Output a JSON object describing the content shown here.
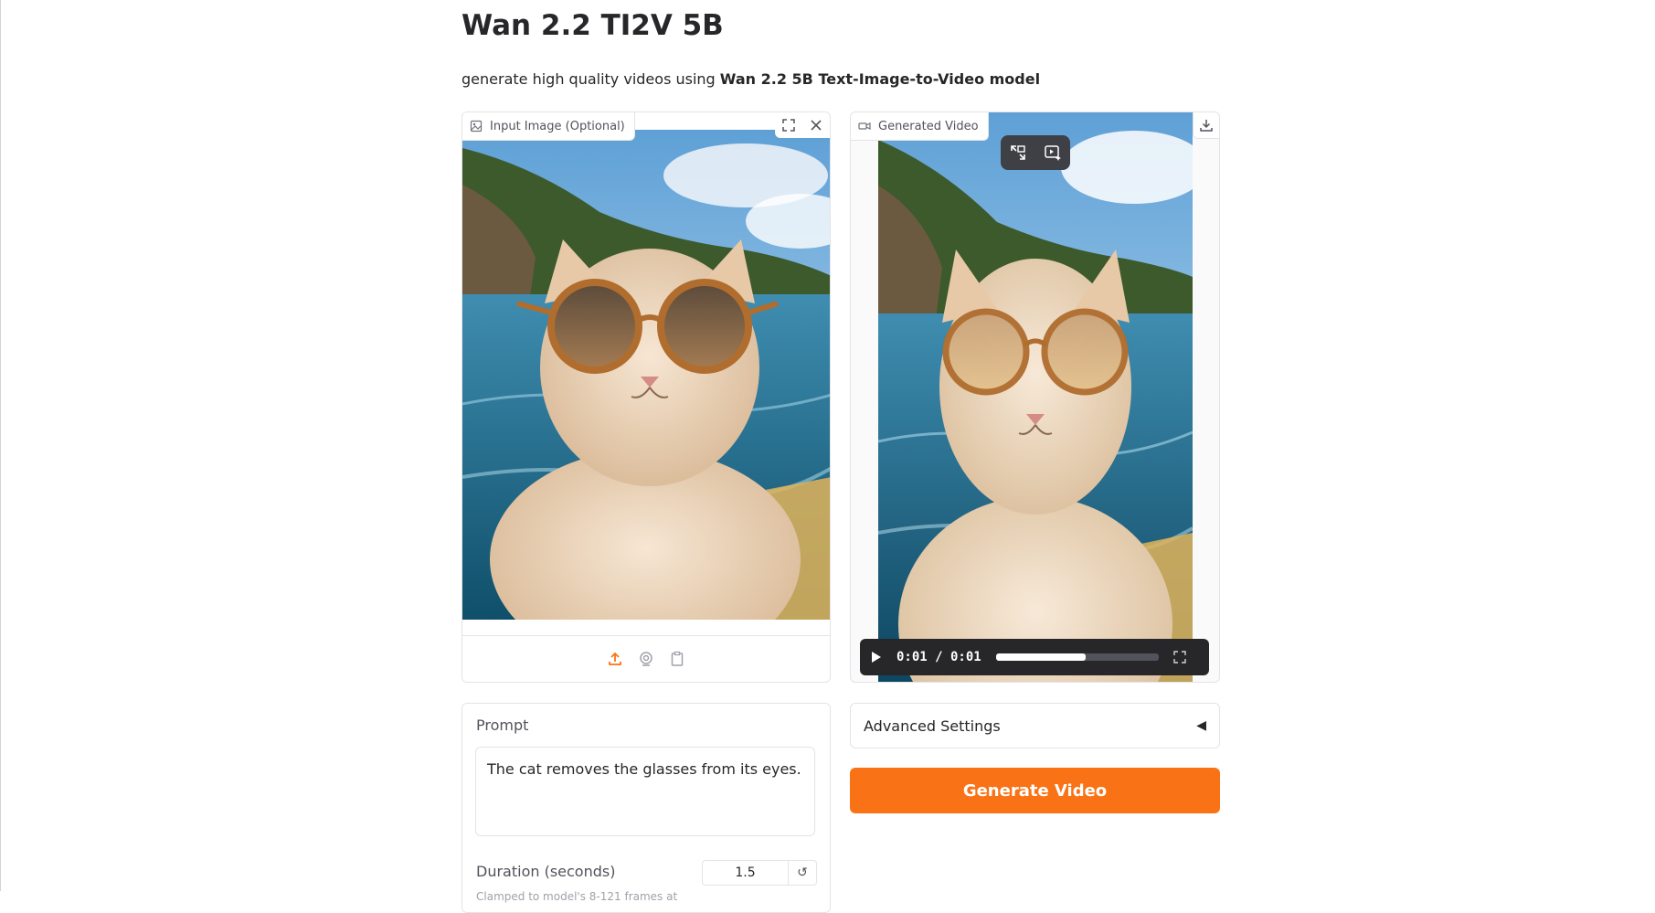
{
  "header": {
    "title": "Wan 2.2 TI2V 5B",
    "subtitle_prefix": "generate high quality videos using ",
    "subtitle_bold": "Wan 2.2 5B Text-Image-to-Video model"
  },
  "input_image": {
    "label": "Input Image (Optional)",
    "tools": [
      "fullscreen-icon",
      "close-icon"
    ],
    "sources": [
      "upload-icon",
      "webcam-icon",
      "clipboard-icon"
    ]
  },
  "output_video": {
    "label": "Generated Video",
    "current_time": "0:01",
    "duration": "0:01",
    "time_display": "0:01 / 0:01",
    "progress": 0.55
  },
  "prompt": {
    "label": "Prompt",
    "value": "The cat removes the glasses from its eyes."
  },
  "duration": {
    "label": "Duration (seconds)",
    "value": "1.5",
    "reset_icon": "↺",
    "hint": "Clamped to model's 8-121 frames at"
  },
  "advanced": {
    "label": "Advanced Settings",
    "arrow": "◀"
  },
  "actions": {
    "generate_label": "Generate Video"
  },
  "colors": {
    "accent": "#f97316",
    "text": "#27272a",
    "border": "#e4e4e7"
  }
}
